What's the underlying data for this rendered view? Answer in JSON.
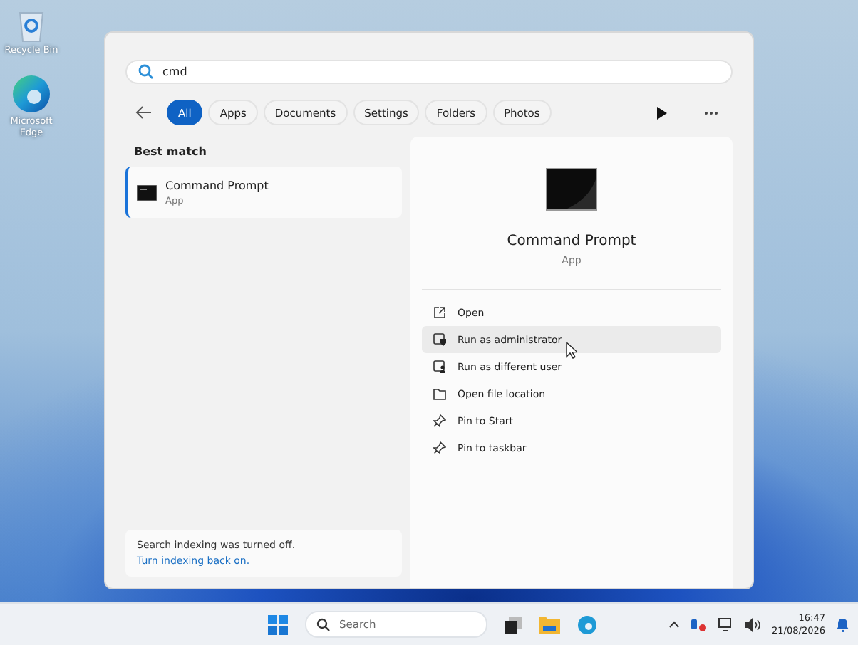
{
  "desktop_icons": [
    {
      "label": "Recycle Bin",
      "kind": "bin"
    },
    {
      "label": "Microsoft Edge",
      "kind": "edge"
    }
  ],
  "search": {
    "value": "cmd"
  },
  "filters": [
    {
      "label": "All",
      "selected": true
    },
    {
      "label": "Apps",
      "selected": false
    },
    {
      "label": "Documents",
      "selected": false
    },
    {
      "label": "Settings",
      "selected": false
    },
    {
      "label": "Folders",
      "selected": false
    },
    {
      "label": "Photos",
      "selected": false
    }
  ],
  "best_match": {
    "heading": "Best match",
    "name": "Command Prompt",
    "type": "App",
    "selected": true
  },
  "indexing_notice": {
    "message": "Search indexing was turned off.",
    "link": "Turn indexing back on."
  },
  "details": {
    "name": "Command Prompt",
    "type": "App",
    "actions": [
      {
        "label": "Open",
        "kind": "open",
        "highlighted": false
      },
      {
        "label": "Run as administrator",
        "kind": "admin",
        "highlighted": true
      },
      {
        "label": "Run as different user",
        "kind": "user",
        "highlighted": false
      },
      {
        "label": "Open file location",
        "kind": "folder",
        "highlighted": false
      },
      {
        "label": "Pin to Start",
        "kind": "pin",
        "highlighted": false
      },
      {
        "label": "Pin to taskbar",
        "kind": "pin",
        "highlighted": false
      }
    ]
  },
  "taskbar": {
    "search_placeholder": "Search",
    "time": "16:47",
    "date": "21/08/2026"
  }
}
